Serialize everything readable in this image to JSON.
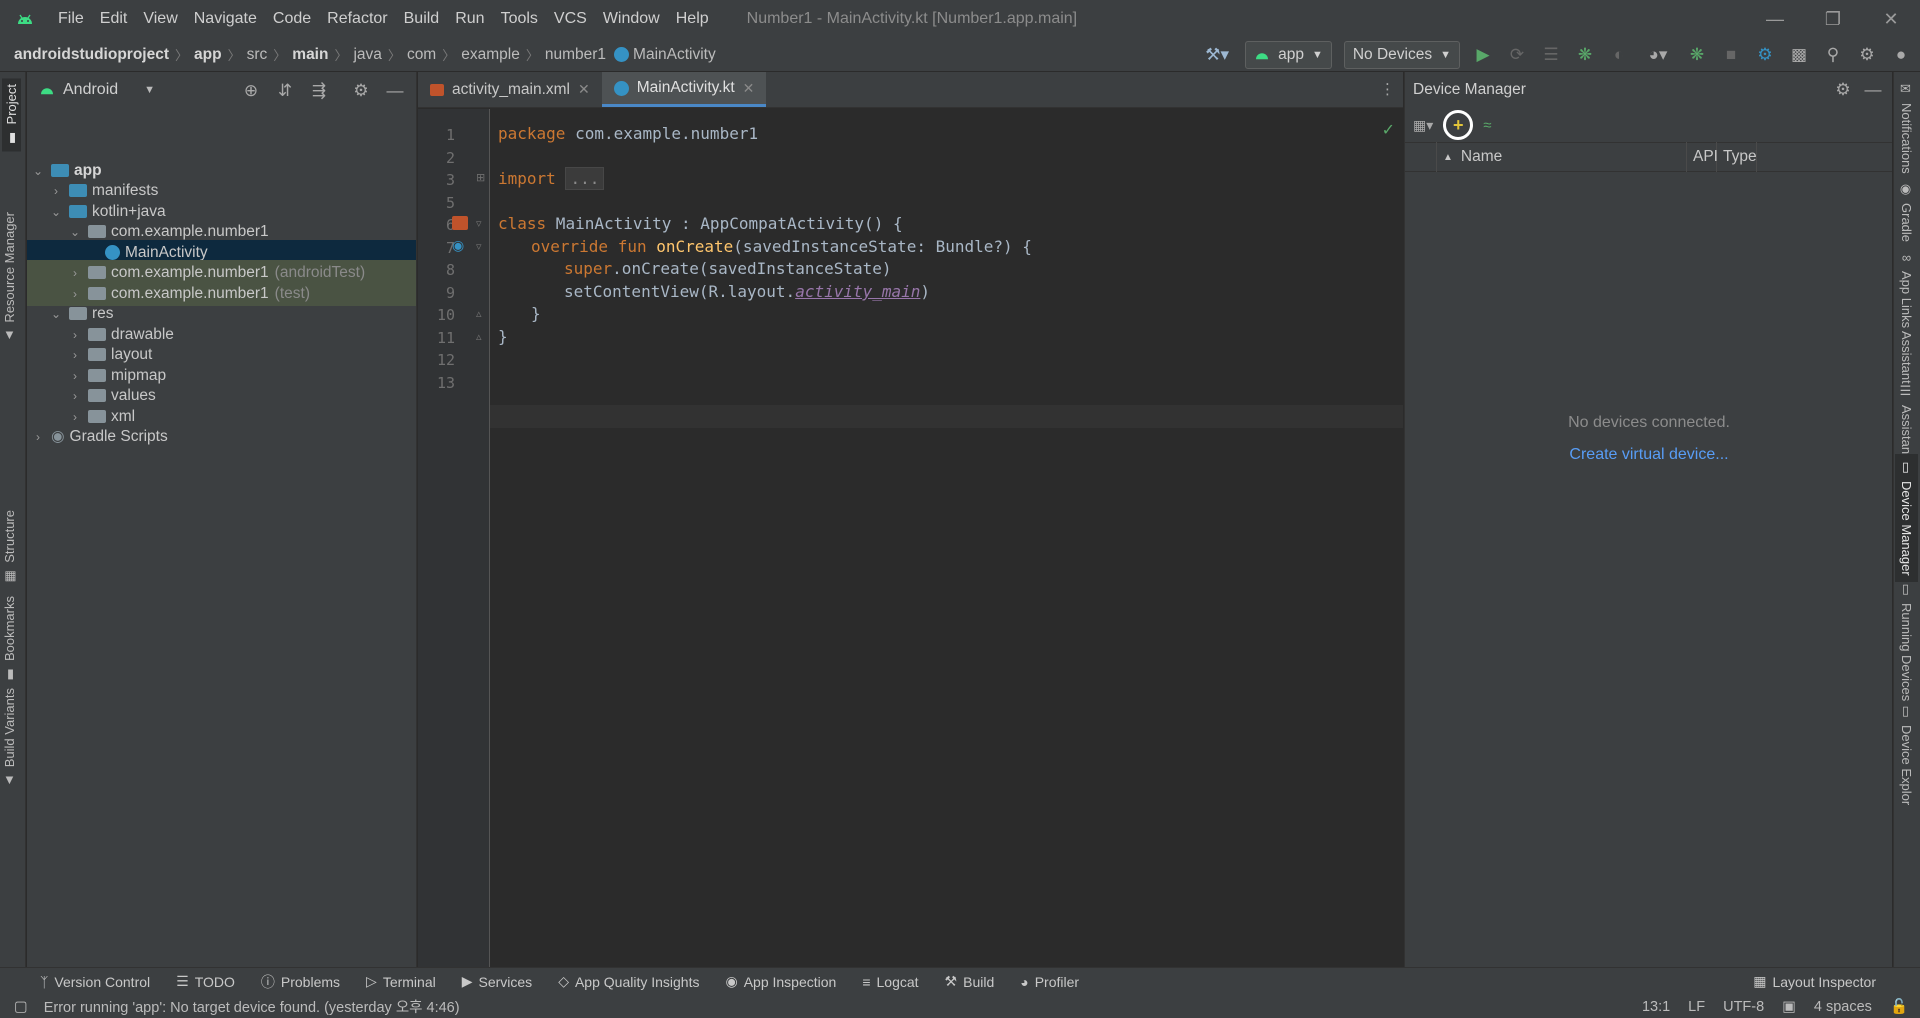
{
  "titlebar": {
    "menu": [
      "File",
      "Edit",
      "View",
      "Navigate",
      "Code",
      "Refactor",
      "Build",
      "Run",
      "Tools",
      "VCS",
      "Window",
      "Help"
    ],
    "window_title": "Number1 - MainActivity.kt [Number1.app.main]"
  },
  "breadcrumbs": [
    "androidstudioproject",
    "app",
    "src",
    "main",
    "java",
    "com",
    "example",
    "number1",
    "MainActivity"
  ],
  "toolbar": {
    "run_config": "app",
    "device": "No Devices"
  },
  "left_stripe": [
    "Project",
    "Resource Manager",
    "Structure",
    "Bookmarks",
    "Build Variants"
  ],
  "right_stripe": [
    "Notifications",
    "Gradle",
    "App Links Assistant",
    "Assistant",
    "Device Manager",
    "Running Devices",
    "Device Explor"
  ],
  "project": {
    "view": "Android",
    "tree": [
      {
        "label": "app",
        "suffix": ""
      },
      {
        "label": "manifests",
        "suffix": ""
      },
      {
        "label": "kotlin+java",
        "suffix": ""
      },
      {
        "label": "com.example.number1",
        "suffix": ""
      },
      {
        "label": "MainActivity",
        "suffix": ""
      },
      {
        "label": "com.example.number1",
        "suffix": "(androidTest)"
      },
      {
        "label": "com.example.number1",
        "suffix": "(test)"
      },
      {
        "label": "res",
        "suffix": ""
      },
      {
        "label": "drawable",
        "suffix": ""
      },
      {
        "label": "layout",
        "suffix": ""
      },
      {
        "label": "mipmap",
        "suffix": ""
      },
      {
        "label": "values",
        "suffix": ""
      },
      {
        "label": "xml",
        "suffix": ""
      },
      {
        "label": "Gradle Scripts",
        "suffix": ""
      }
    ]
  },
  "editor": {
    "tabs": [
      "activity_main.xml",
      "MainActivity.kt"
    ],
    "line_numbers": [
      "1",
      "2",
      "3",
      "5",
      "6",
      "7",
      "8",
      "9",
      "10",
      "11",
      "12",
      "13"
    ],
    "code": {
      "l1_kw": "package",
      "l1_rest": " com.example.number1",
      "l3_kw": "import",
      "l3_fold": "...",
      "l6_kw": "class",
      "l6_rest": " MainActivity : AppCompatActivity() {",
      "l7_kw": "override fun",
      "l7_fn": "onCreate",
      "l7_rest": "(savedInstanceState: Bundle?) {",
      "l8_kw": "super",
      "l8_rest": ".onCreate(savedInstanceState)",
      "l9_a": "setContentView(R.layout.",
      "l9_ref": "activity_main",
      "l9_b": ")",
      "l10": "}",
      "l11": "}"
    }
  },
  "device_manager": {
    "title": "Device Manager",
    "columns": [
      "Name",
      "API",
      "Type"
    ],
    "empty_text": "No devices connected.",
    "create_link": "Create virtual device..."
  },
  "bottom_tools": [
    "Version Control",
    "TODO",
    "Problems",
    "Terminal",
    "Services",
    "App Quality Insights",
    "App Inspection",
    "Logcat",
    "Build",
    "Profiler"
  ],
  "layout_inspector": "Layout Inspector",
  "status": {
    "message": "Error running 'app': No target device found. (yesterday 오후 4:46)",
    "position": "13:1",
    "line_sep": "LF",
    "encoding": "UTF-8",
    "indent": "4 spaces"
  },
  "colors": {
    "accent": "#4a88c7",
    "link": "#589df6",
    "keyword": "#cc7832",
    "function": "#ffc66d",
    "run_green": "#59a869"
  }
}
